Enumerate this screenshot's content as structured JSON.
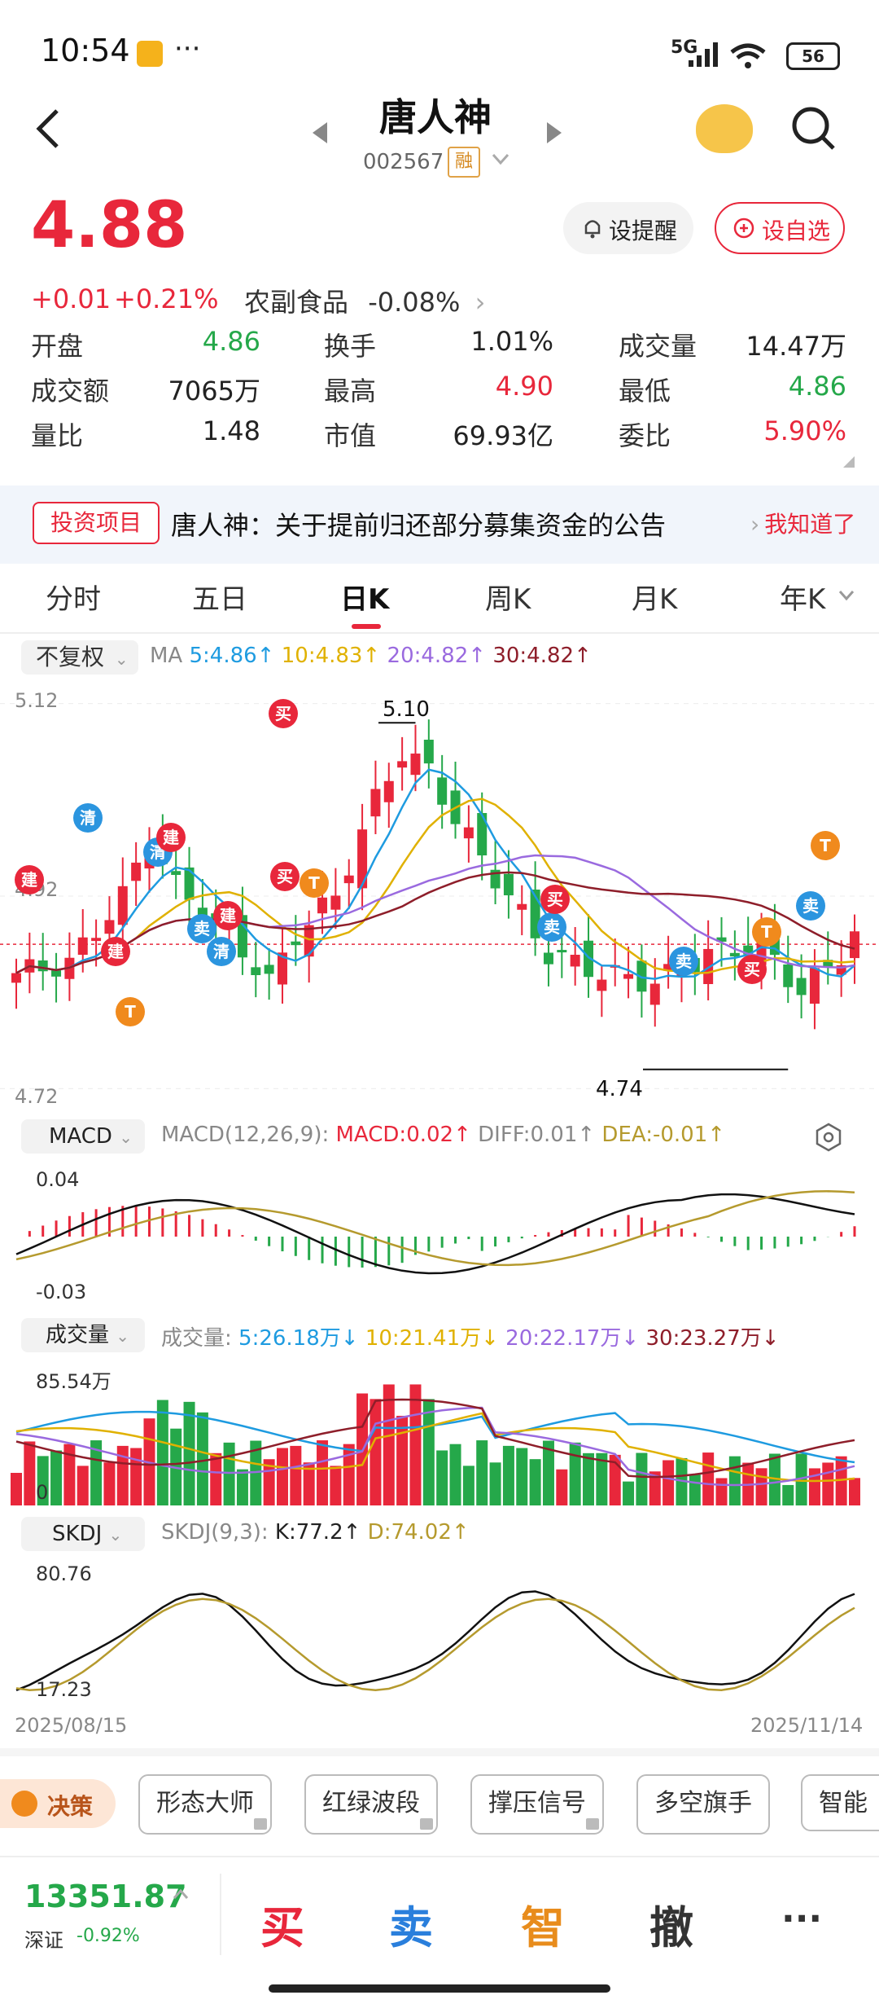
{
  "status_bar": {
    "time": "10:54",
    "dots": "···",
    "network": "5G",
    "battery": "56"
  },
  "header": {
    "title": "唐人神",
    "code": "002567",
    "margin_tag": "融"
  },
  "quote": {
    "price": "4.88",
    "change": "+0.01",
    "change_pct": "+0.21%",
    "sector": "农副食品",
    "sector_change": "-0.08%",
    "alert_btn": "设提醒",
    "watch_btn": "设自选"
  },
  "stats": [
    {
      "label": "开盘",
      "value": "4.86",
      "color": "#25a84a"
    },
    {
      "label": "换手",
      "value": "1.01%",
      "color": "#222222"
    },
    {
      "label": "成交量",
      "value": "14.47万",
      "color": "#222222"
    },
    {
      "label": "成交额",
      "value": "7065万",
      "color": "#222222"
    },
    {
      "label": "最高",
      "value": "4.90",
      "color": "#e8273b"
    },
    {
      "label": "最低",
      "value": "4.86",
      "color": "#25a84a"
    },
    {
      "label": "量比",
      "value": "1.48",
      "color": "#222222"
    },
    {
      "label": "市值",
      "value": "69.93亿",
      "color": "#222222"
    },
    {
      "label": "委比",
      "value": "5.90%",
      "color": "#e8273b"
    }
  ],
  "notice": {
    "tag": "投资项目",
    "text": "唐人神：关于提前归还部分募集资金的公告",
    "dismiss": "我知道了"
  },
  "period_tabs": [
    "分时",
    "五日",
    "日K",
    "周K",
    "月K",
    "年K"
  ],
  "kline": {
    "adjust": "不复权",
    "ma_label": "MA",
    "ma5": "5:4.86↑",
    "ma10": "10:4.83↑",
    "ma20": "20:4.82↑",
    "ma30": "30:4.82↑",
    "ymax": "5.12",
    "ymid": "4.92",
    "ymin": "4.72",
    "high_mark": "5.10",
    "low_mark": "4.74",
    "date_start": "2025/08/15",
    "date_end": "2025/11/14"
  },
  "macd": {
    "name": "MACD",
    "params": "MACD(12,26,9):",
    "macd": "MACD:0.02↑",
    "diff": "DIFF:0.01↑",
    "dea": "DEA:-0.01↑",
    "ymax": "0.04",
    "ymin": "-0.03"
  },
  "volume": {
    "name": "成交量",
    "label": "成交量:",
    "v5": "5:26.18万↓",
    "v10": "10:21.41万↓",
    "v20": "20:22.17万↓",
    "v30": "30:23.27万↓",
    "ymax": "85.54万",
    "ymin": "0"
  },
  "skdj": {
    "name": "SKDJ",
    "params": "SKDJ(9,3):",
    "k": "K:77.2↑",
    "d": "D:74.02↑",
    "ymax": "80.76",
    "ymin": "17.23"
  },
  "tools": {
    "decision": "决策",
    "items": [
      "形态大师",
      "红绿波段",
      "撑压信号",
      "多空旗手",
      "智能"
    ]
  },
  "footer": {
    "index_value": "13351.87",
    "index_name": "深证",
    "index_change": "-0.92%",
    "buy": "买",
    "sell": "卖",
    "smart": "智",
    "cancel": "撤",
    "more": "···"
  },
  "markers": [
    "建",
    "清",
    "建",
    "清",
    "建",
    "卖",
    "清",
    "建",
    "买",
    "买",
    "T",
    "T",
    "卖",
    "买",
    "卖",
    "买",
    "T",
    "卖",
    "T"
  ]
}
